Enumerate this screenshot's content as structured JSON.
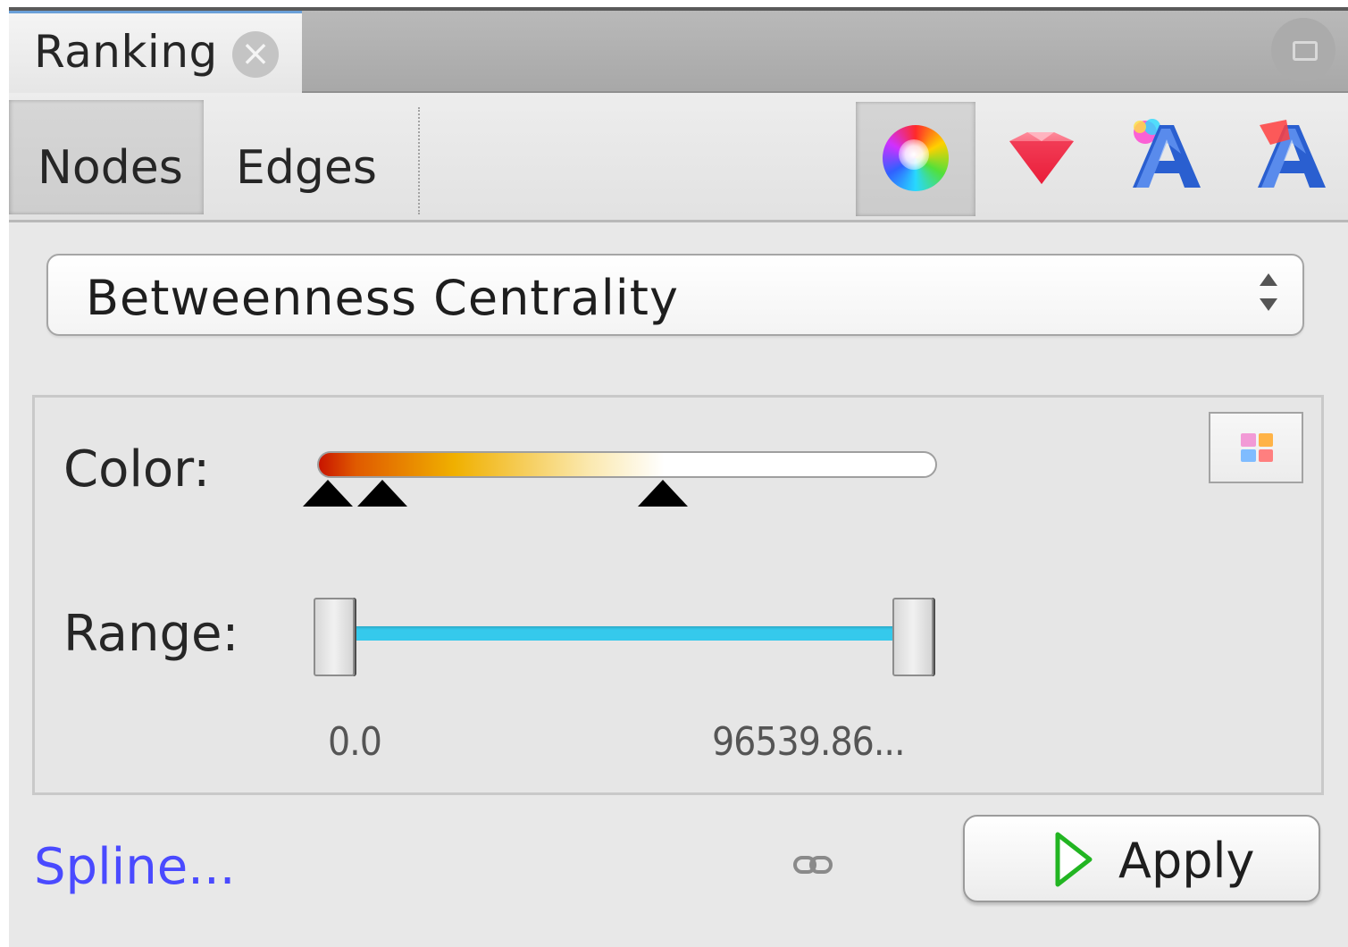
{
  "tab": {
    "title": "Ranking",
    "close_glyph": "×"
  },
  "toolbar": {
    "nodes_label": "Nodes",
    "edges_label": "Edges",
    "tools": [
      "color-wheel-icon",
      "size-diamond-icon",
      "label-color-icon",
      "label-size-icon"
    ]
  },
  "ranking_select": {
    "value": "Betweenness Centrality"
  },
  "color": {
    "label": "Color:",
    "gradient_colors": [
      "#c81400",
      "#e05a00",
      "#f0b000",
      "#fbe9b0",
      "#ffffff"
    ],
    "stops": [
      0.0,
      0.09,
      0.55
    ]
  },
  "range": {
    "label": "Range:",
    "min_value": "0.0",
    "max_value": "96539.86...",
    "low_fraction": 0.0,
    "high_fraction": 1.0,
    "track_color": "#35c9ec"
  },
  "footer": {
    "spline_label": "Spline...",
    "apply_label": "Apply"
  }
}
